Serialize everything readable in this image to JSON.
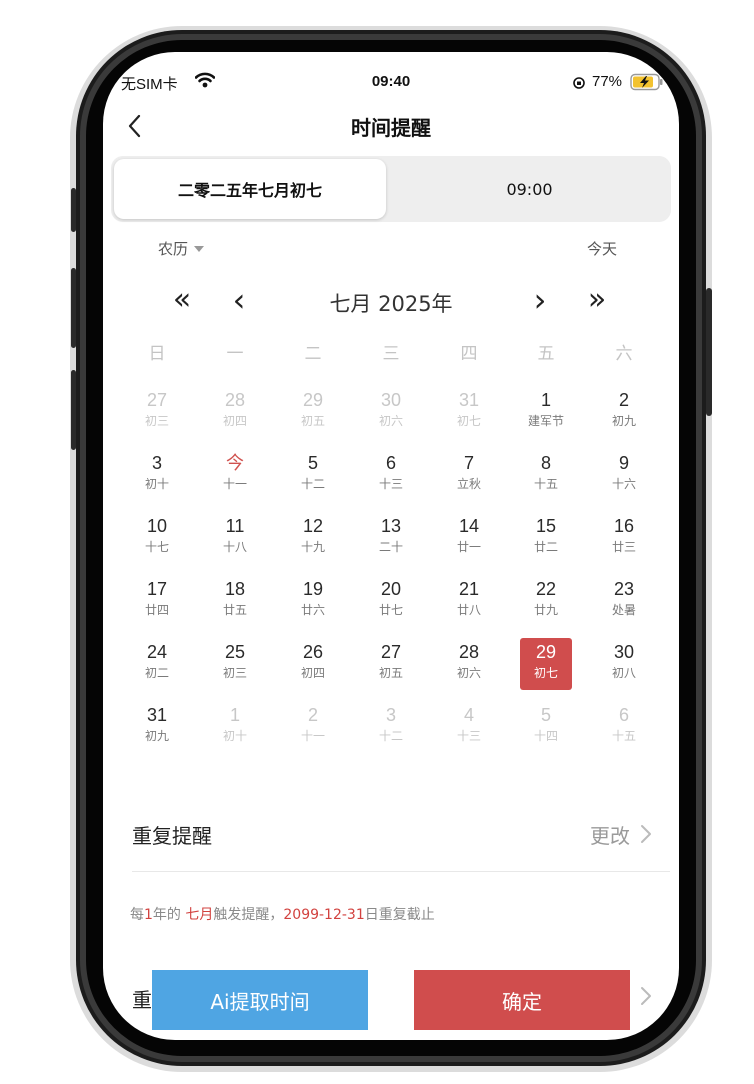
{
  "status_bar": {
    "carrier": "无SIM卡",
    "time": "09:40",
    "battery": "77%"
  },
  "header": {
    "title": "时间提醒"
  },
  "segments": {
    "date": "二零二五年七月初七",
    "time": "09:00"
  },
  "calendar_mode": {
    "label": "农历",
    "today_link": "今天"
  },
  "month_nav": {
    "title": "七月 2025年",
    "prev_year": "«",
    "prev_month": "‹",
    "next_month": "›",
    "next_year": "»"
  },
  "weekdays": [
    "日",
    "一",
    "二",
    "三",
    "四",
    "五",
    "六"
  ],
  "weeks": [
    [
      {
        "num": "27",
        "lunar": "初三",
        "type": "other"
      },
      {
        "num": "28",
        "lunar": "初四",
        "type": "other"
      },
      {
        "num": "29",
        "lunar": "初五",
        "type": "other"
      },
      {
        "num": "30",
        "lunar": "初六",
        "type": "other"
      },
      {
        "num": "31",
        "lunar": "初七",
        "type": "other"
      },
      {
        "num": "1",
        "lunar": "建军节",
        "type": "normal"
      },
      {
        "num": "2",
        "lunar": "初九",
        "type": "normal"
      }
    ],
    [
      {
        "num": "3",
        "lunar": "初十",
        "type": "normal"
      },
      {
        "num": "今",
        "lunar": "十一",
        "type": "today"
      },
      {
        "num": "5",
        "lunar": "十二",
        "type": "normal"
      },
      {
        "num": "6",
        "lunar": "十三",
        "type": "normal"
      },
      {
        "num": "7",
        "lunar": "立秋",
        "type": "normal"
      },
      {
        "num": "8",
        "lunar": "十五",
        "type": "normal"
      },
      {
        "num": "9",
        "lunar": "十六",
        "type": "normal"
      }
    ],
    [
      {
        "num": "10",
        "lunar": "十七",
        "type": "normal"
      },
      {
        "num": "11",
        "lunar": "十八",
        "type": "normal"
      },
      {
        "num": "12",
        "lunar": "十九",
        "type": "normal"
      },
      {
        "num": "13",
        "lunar": "二十",
        "type": "normal"
      },
      {
        "num": "14",
        "lunar": "廿一",
        "type": "normal"
      },
      {
        "num": "15",
        "lunar": "廿二",
        "type": "normal"
      },
      {
        "num": "16",
        "lunar": "廿三",
        "type": "normal"
      }
    ],
    [
      {
        "num": "17",
        "lunar": "廿四",
        "type": "normal"
      },
      {
        "num": "18",
        "lunar": "廿五",
        "type": "normal"
      },
      {
        "num": "19",
        "lunar": "廿六",
        "type": "normal"
      },
      {
        "num": "20",
        "lunar": "廿七",
        "type": "normal"
      },
      {
        "num": "21",
        "lunar": "廿八",
        "type": "normal"
      },
      {
        "num": "22",
        "lunar": "廿九",
        "type": "normal"
      },
      {
        "num": "23",
        "lunar": "处暑",
        "type": "normal"
      }
    ],
    [
      {
        "num": "24",
        "lunar": "初二",
        "type": "normal"
      },
      {
        "num": "25",
        "lunar": "初三",
        "type": "normal"
      },
      {
        "num": "26",
        "lunar": "初四",
        "type": "normal"
      },
      {
        "num": "27",
        "lunar": "初五",
        "type": "normal"
      },
      {
        "num": "28",
        "lunar": "初六",
        "type": "normal"
      },
      {
        "num": "29",
        "lunar": "初七",
        "type": "selected"
      },
      {
        "num": "30",
        "lunar": "初八",
        "type": "normal"
      }
    ],
    [
      {
        "num": "31",
        "lunar": "初九",
        "type": "normal"
      },
      {
        "num": "1",
        "lunar": "初十",
        "type": "other"
      },
      {
        "num": "2",
        "lunar": "十一",
        "type": "other"
      },
      {
        "num": "3",
        "lunar": "十二",
        "type": "other"
      },
      {
        "num": "4",
        "lunar": "十三",
        "type": "other"
      },
      {
        "num": "5",
        "lunar": "十四",
        "type": "other"
      },
      {
        "num": "6",
        "lunar": "十五",
        "type": "other"
      }
    ]
  ],
  "repeat": {
    "label": "重复提醒",
    "change": "更改"
  },
  "summary": {
    "p1": "每",
    "p2": "1",
    "p3": "年的 ",
    "p4": "七月",
    "p5": "触发提醒，",
    "p6": "2099-12-31",
    "p7": "日重复截止"
  },
  "partial_row": {
    "label": "重"
  },
  "buttons": {
    "ai": "Ai提取时间",
    "confirm": "确定"
  },
  "colors": {
    "accent_red": "#d04d4d",
    "ai_blue": "#4fa5e3"
  },
  "icons": [
    "back-icon",
    "wifi-icon",
    "orientation-lock-icon",
    "battery-charging-icon",
    "dropdown-caret-icon",
    "chevron-right-icon"
  ]
}
